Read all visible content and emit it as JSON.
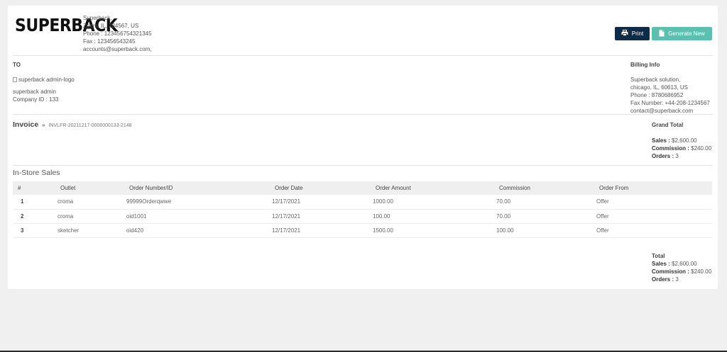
{
  "brand": {
    "logo_text": "SUPERBACK",
    "name": "Superback,",
    "address": "Zoom, IL, 234567, US",
    "phone": "Phone : 123456754321345",
    "fax": "Fax : 123456543245",
    "email": "accounts@superback.com,"
  },
  "actions": {
    "print_label": "Print",
    "generate_label": "Generate New"
  },
  "to": {
    "heading": "TO",
    "logo_alt": "superback admin-logo",
    "name": "superback admin",
    "company_id": "Company ID : 133"
  },
  "billing": {
    "heading": "Billing Info",
    "name": "Superback solution,",
    "address": "chicago, IL, 60613, US",
    "phone": "Phone : 8780686952",
    "fax": "Fax Number: +44-208-1234567",
    "email": "contact@superback.com"
  },
  "invoice": {
    "title": "Invoice",
    "separator": "»",
    "number": "INVLFR-20211217-0000000133-2148"
  },
  "grand_total": {
    "heading": "Grand Total",
    "sales_label": "Sales :",
    "sales_value": "$2,600.00",
    "commission_label": "Commission :",
    "commission_value": "$240.00",
    "orders_label": "Orders :",
    "orders_value": "3"
  },
  "section_title": "In-Store Sales",
  "table": {
    "headers": [
      "#",
      "Outlet",
      "Order Number/ID",
      "Order Date",
      "Order Amount",
      "Commission",
      "Order From"
    ],
    "rows": [
      [
        "1",
        "croma",
        "99999Orderqwwe",
        "12/17/2021",
        "1000.00",
        "70.00",
        "Offer"
      ],
      [
        "2",
        "croma",
        "oid1001",
        "12/17/2021",
        "100.00",
        "70.00",
        "Offer"
      ],
      [
        "3",
        "sketcher",
        "oid420",
        "12/17/2021",
        "1500.00",
        "100.00",
        "Offer"
      ]
    ]
  },
  "total": {
    "heading": "Total",
    "sales_label": "Sales :",
    "sales_value": "$2,600.00",
    "commission_label": "Commission :",
    "commission_value": "$240.00",
    "orders_label": "Orders :",
    "orders_value": "3"
  },
  "colors": {
    "print_button": "#0f2b47",
    "generate_button": "#5bc0b0",
    "background": "#f0f0f0"
  },
  "icons": {
    "print": "printer-icon",
    "generate": "document-icon"
  }
}
